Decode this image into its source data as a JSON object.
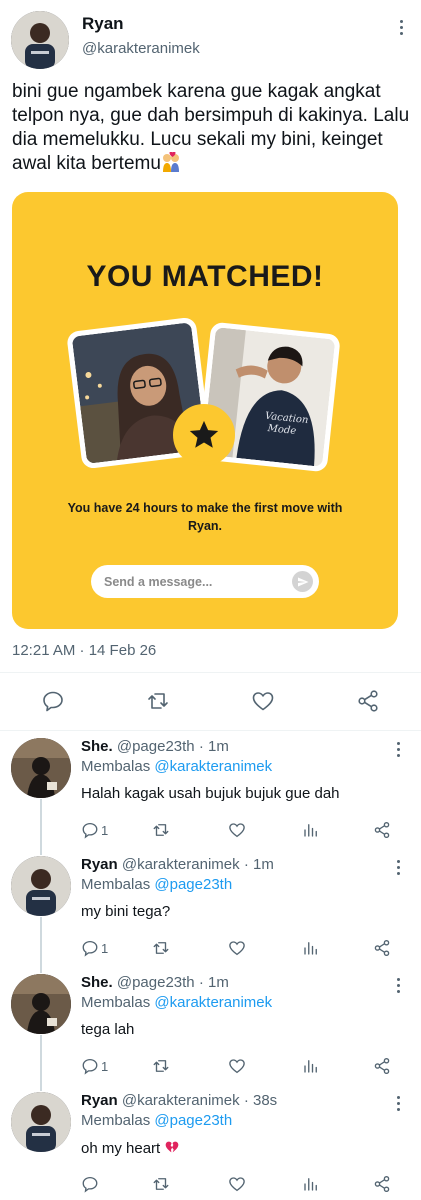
{
  "tweet": {
    "author_name": "Ryan",
    "author_handle": "@karakteranimek",
    "text": "bini gue ngambek karena gue kagak angkat telpon nya, gue dah bersimpuh di kakinya. Lalu dia memelukku. Lucu sekali my bini, keinget awal kita bertemu",
    "emoji_icon": "kiss-couple-icon",
    "timestamp": "12:21 AM · 14 Feb 26"
  },
  "card": {
    "title": "YOU MATCHED!",
    "caption": "You have 24 hours to make the first move with Ryan.",
    "message_placeholder": "Send a message...",
    "background_color": "#fcc82f"
  },
  "actions": [
    "reply-icon",
    "retweet-icon",
    "like-icon",
    "share-icon"
  ],
  "colors": {
    "link": "#1d9bf0",
    "muted": "#536471",
    "text": "#0f1419",
    "heart_emoji": "#e0245e"
  },
  "replies": [
    {
      "name": "She.",
      "handle": "@page23th",
      "time": "1m",
      "replying_label": "Membalas",
      "replying_to": "@karakteranimek",
      "text": "Halah kagak usah bujuk bujuk gue dah",
      "reply_count": "1"
    },
    {
      "name": "Ryan",
      "handle": "@karakteranimek",
      "time": "1m",
      "replying_label": "Membalas",
      "replying_to": "@page23th",
      "text": "my bini tega?",
      "reply_count": "1"
    },
    {
      "name": "She.",
      "handle": "@page23th",
      "time": "1m",
      "replying_label": "Membalas",
      "replying_to": "@karakteranimek",
      "text": "tega lah",
      "reply_count": "1"
    },
    {
      "name": "Ryan",
      "handle": "@karakteranimek",
      "time": "38s",
      "replying_label": "Membalas",
      "replying_to": "@page23th",
      "text": "oh my heart",
      "text_emoji": "broken-heart-icon",
      "reply_count": ""
    }
  ]
}
